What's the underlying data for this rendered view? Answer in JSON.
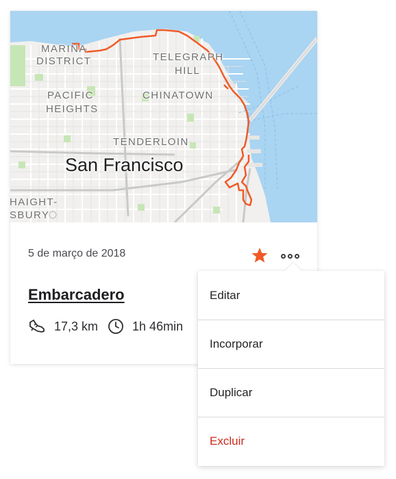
{
  "map": {
    "labels": {
      "marina": "MARINA",
      "district": "DISTRICT",
      "telegraph": "TELEGRAPH",
      "hill": "HILL",
      "pacific": "PACIFIC",
      "heights": "HEIGHTS",
      "chinatown": "CHINATOWN",
      "tenderloin": "TENDERLOIN",
      "city": "San Francisco",
      "haight": "HAIGHT-",
      "ashbury": "SBURY"
    },
    "colors": {
      "route": "#f05a28",
      "water": "#a9d4f2",
      "park": "#c7e6b6"
    }
  },
  "activity": {
    "date": "5 de março de 2018",
    "title": "Embarcadero",
    "distance": "17,3 km",
    "duration": "1h 46min",
    "starred": true,
    "star_color": "#f05a28"
  },
  "menu": {
    "items": [
      {
        "label": "Editar"
      },
      {
        "label": "Incorporar"
      },
      {
        "label": "Duplicar"
      },
      {
        "label": "Excluir",
        "danger": true
      }
    ],
    "danger_color": "#cc2a1d"
  },
  "icons": {
    "star": "star-icon",
    "more": "more-options-icon",
    "shoe": "shoe-icon",
    "clock": "clock-icon"
  }
}
